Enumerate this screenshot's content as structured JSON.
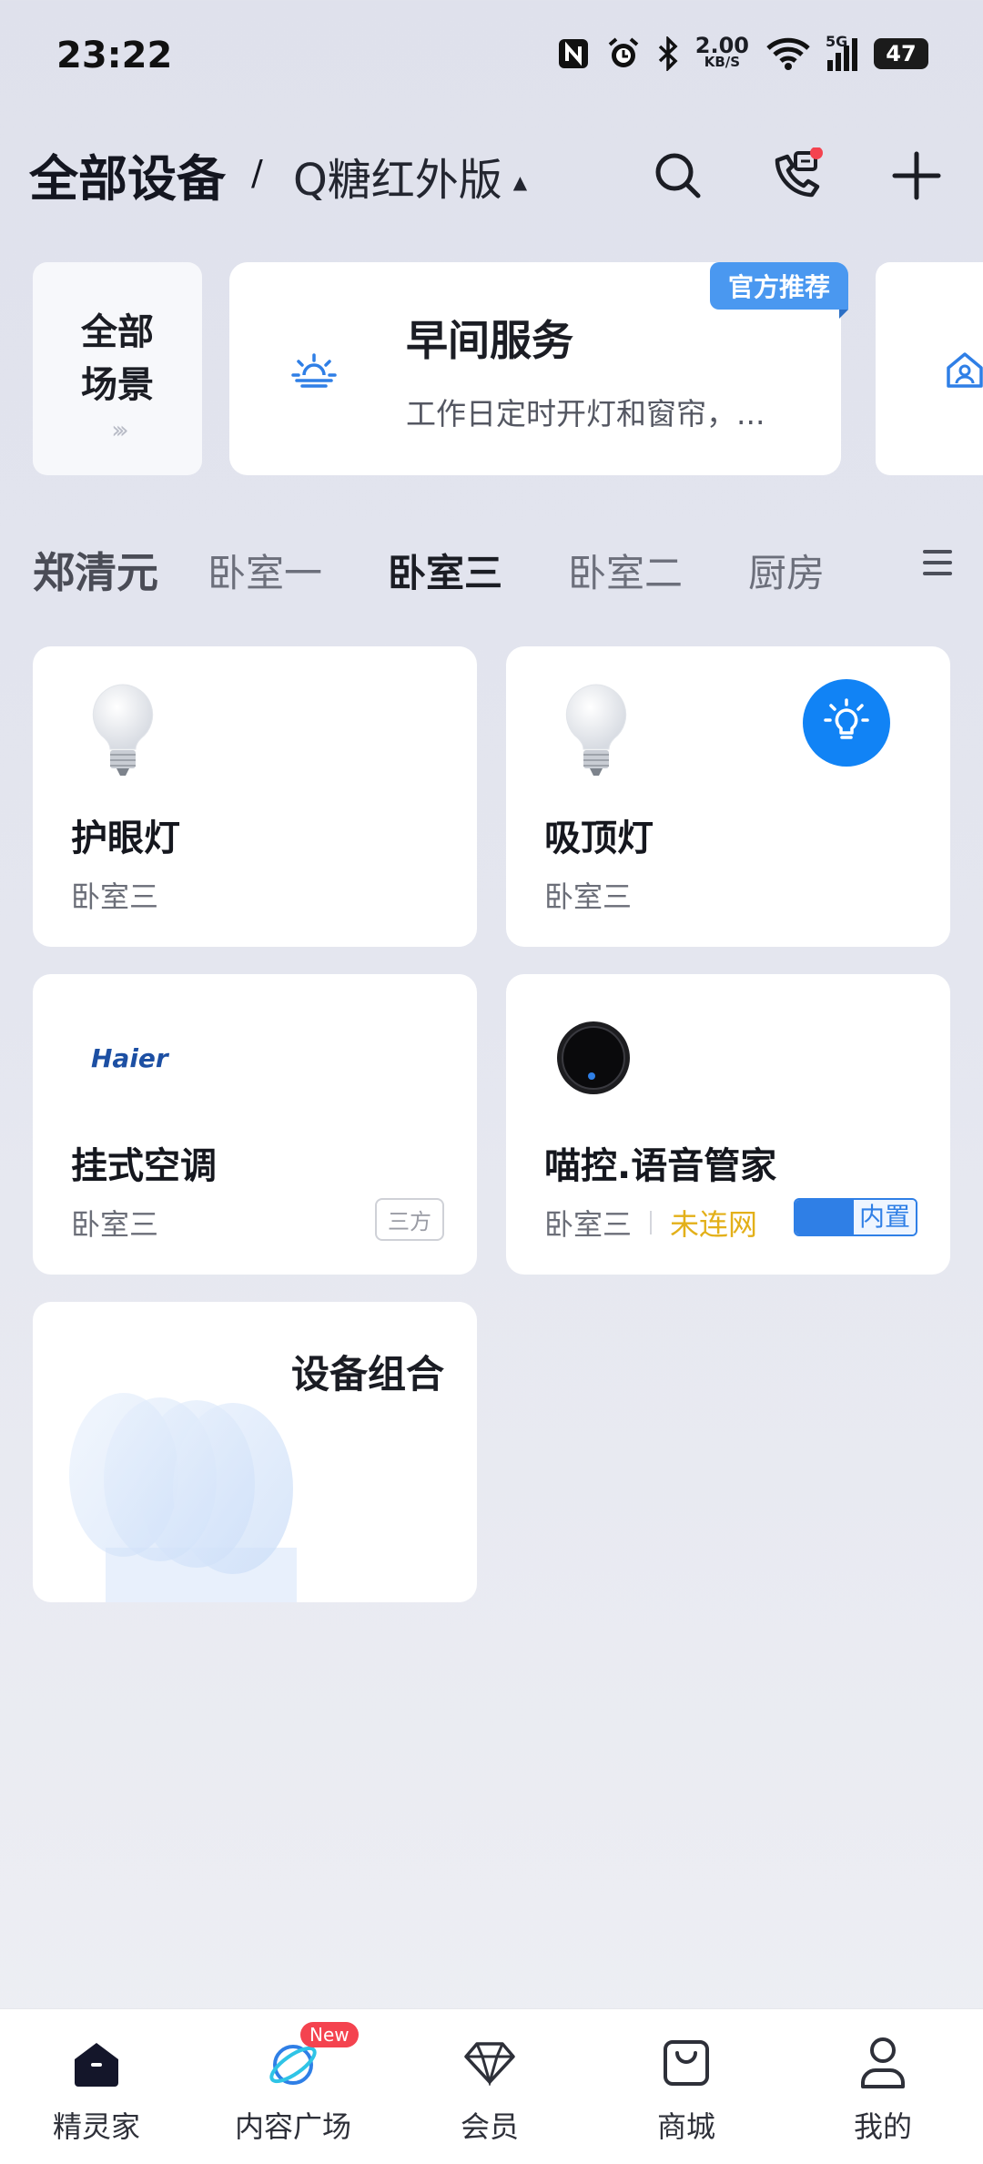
{
  "status_bar": {
    "time": "23:22",
    "net_speed_value": "2.00",
    "net_speed_unit": "KB/S",
    "network": "5G",
    "battery": "47"
  },
  "header": {
    "title": "全部设备",
    "separator": "/",
    "home_name": "Q糖红外版",
    "home_caret": "▲"
  },
  "scenes": {
    "all_label": "全部\n场景",
    "all_arrow": "›››",
    "cards": [
      {
        "title": "早间服务",
        "desc": "工作日定时开灯和窗帘，...",
        "badge": "官方推荐"
      }
    ]
  },
  "room_tabs": {
    "owner": "郑清元",
    "rooms": [
      "卧室一",
      "卧室三",
      "卧室二",
      "厨房"
    ],
    "active": "卧室三"
  },
  "devices": [
    {
      "name": "护眼灯",
      "room": "卧室三",
      "icon": "bulb-icon"
    },
    {
      "name": "吸顶灯",
      "room": "卧室三",
      "icon": "bulb-icon"
    },
    {
      "name": "挂式空调",
      "room": "卧室三",
      "brand": "Haier",
      "tag": "三方"
    },
    {
      "name": "喵控.语音管家",
      "room": "卧室三",
      "status": "未连网",
      "tag": "内置",
      "icon": "speaker-icon"
    },
    {
      "name": "设备组合"
    }
  ],
  "nav": [
    {
      "label": "精灵家",
      "icon": "home-icon"
    },
    {
      "label": "内容广场",
      "icon": "planet-icon",
      "badge": "New"
    },
    {
      "label": "会员",
      "icon": "diamond-icon"
    },
    {
      "label": "商城",
      "icon": "bag-icon"
    },
    {
      "label": "我的",
      "icon": "person-icon"
    }
  ],
  "colors": {
    "accent": "#1183f5",
    "badge": "#4a98f0",
    "offline": "#e3b019",
    "new_badge": "#f4434f"
  }
}
